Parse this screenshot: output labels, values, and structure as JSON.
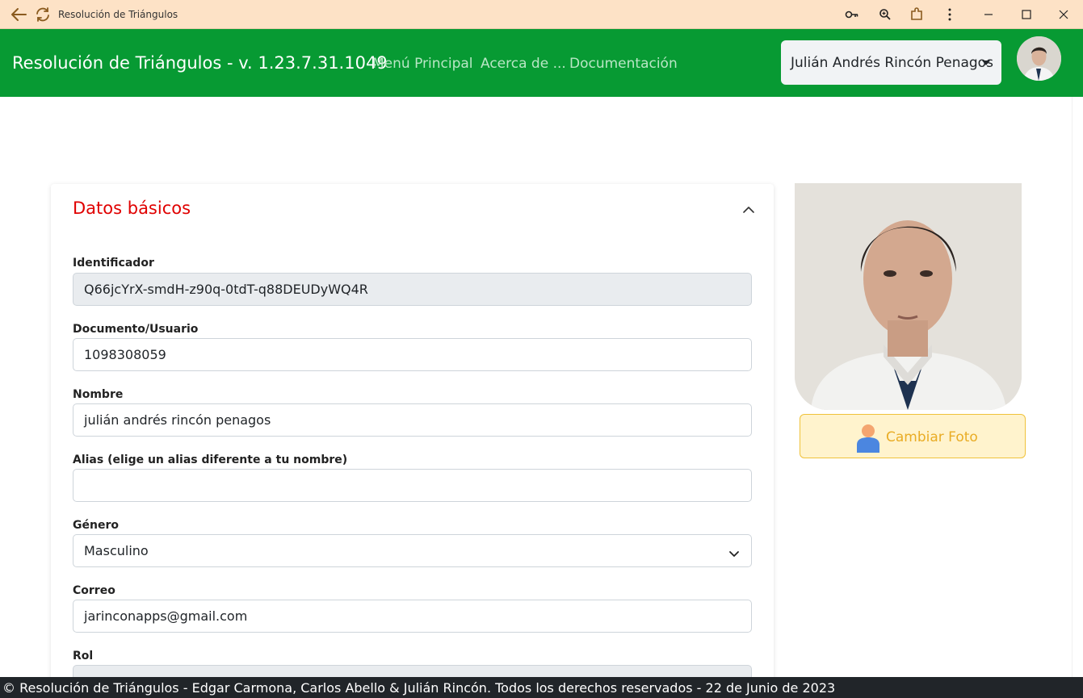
{
  "window": {
    "title": "Resolución de Triángulos"
  },
  "navbar": {
    "brand": "Resolución de Triángulos - v. 1.23.7.31.1049",
    "links": [
      "Menú Principal",
      "Acerca de ...",
      "Documentación"
    ],
    "user_name": "Julián Andrés Rincón Penagos"
  },
  "card": {
    "title": "Datos básicos",
    "fields": [
      {
        "label": "Identificador",
        "value": "Q66jcYrX-smdH-z90q-0tdT-q88DEUDyWQ4R",
        "readonly": true
      },
      {
        "label": "Documento/Usuario",
        "value": "1098308059"
      },
      {
        "label": "Nombre",
        "value": "julián andrés rincón penagos"
      },
      {
        "label": "Alias (elige un alias diferente a tu nombre)",
        "value": ""
      },
      {
        "label": "Género",
        "value": "Masculino"
      },
      {
        "label": "Correo",
        "value": "jarinconapps@gmail.com"
      },
      {
        "label": "Rol",
        "value": "",
        "readonly": true
      }
    ]
  },
  "photo": {
    "button_label": "Cambiar Foto"
  },
  "footer": {
    "text": "© Resolución de Triángulos - Edgar Carmona, Carlos Abello & Julián Rincón. Todos los derechos reservados - 22 de Junio de 2023"
  },
  "colors": {
    "navbar": "#079a33",
    "title_red": "#e00000",
    "photo_button_bg": "#fff3cd",
    "photo_button_text": "#e9ac25",
    "footer": "#212529"
  }
}
